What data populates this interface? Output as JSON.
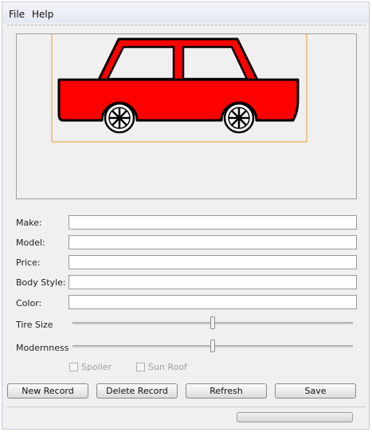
{
  "menu": {
    "file": "File",
    "help": "Help"
  },
  "car": {
    "body_color": "#ff0000",
    "outline_color": "#000000",
    "selection_color": "#e8a030"
  },
  "form": {
    "make_label": "Make:",
    "model_label": "Model:",
    "price_label": "Price:",
    "body_style_label": "Body Style:",
    "color_label": "Color:",
    "make_value": "",
    "model_value": "",
    "price_value": "",
    "body_style_value": "",
    "color_value": ""
  },
  "sliders": {
    "tire_size_label": "Tire Size",
    "tire_size_level": 0.5,
    "modernness_label": "Modernness",
    "modernness_level": 0.5
  },
  "options": {
    "spoiler_label": "Spoiler",
    "spoiler_checked": false,
    "sunroof_label": "Sun Roof",
    "sunroof_checked": false
  },
  "buttons": {
    "new_record": "New Record",
    "delete_record": "Delete Record",
    "refresh": "Refresh",
    "save": "Save"
  },
  "status": {
    "progress_level": 0
  }
}
